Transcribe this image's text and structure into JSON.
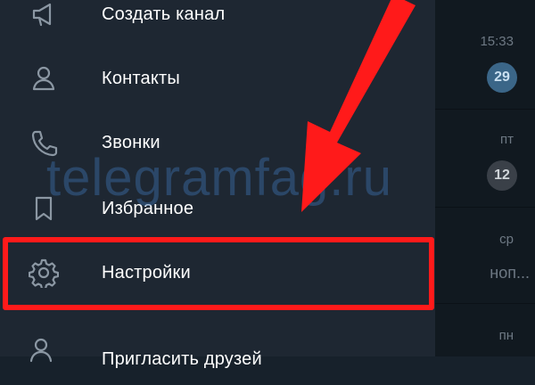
{
  "menu": {
    "items": [
      {
        "label": "Создать канал",
        "icon": "megaphone-icon"
      },
      {
        "label": "Контакты",
        "icon": "person-icon"
      },
      {
        "label": "Звонки",
        "icon": "phone-icon"
      },
      {
        "label": "Избранное",
        "icon": "bookmark-icon"
      },
      {
        "label": "Настройки",
        "icon": "gear-icon"
      },
      {
        "label": "Пригласить друзей",
        "icon": "add-person-icon"
      }
    ]
  },
  "chats": [
    {
      "time": "15:33",
      "badge": "29"
    },
    {
      "time": "пт",
      "badge": "12"
    },
    {
      "time": "ср",
      "snippet": "ноп..."
    },
    {
      "time": "пн"
    }
  ],
  "watermark": "telegramfag.ru",
  "colors": {
    "highlight": "#ff1a1a",
    "drawer_bg": "#1e2732",
    "chat_bg": "#111920"
  }
}
